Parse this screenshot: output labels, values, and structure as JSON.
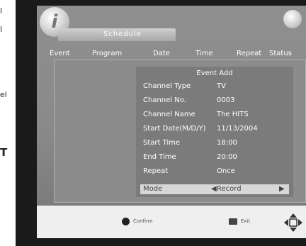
{
  "edge_fragments": [
    "l",
    "l",
    "el",
    "T"
  ],
  "screen": {
    "title": "Schedule",
    "columns": [
      "Event",
      "Program",
      "Date",
      "Time",
      "Repeat",
      "Status"
    ]
  },
  "dialog": {
    "title": "Event Add",
    "rows": [
      {
        "label": "Channel Type",
        "value": "TV"
      },
      {
        "label": "Channel No.",
        "value": "0003"
      },
      {
        "label": "Channel Name",
        "value": "The HITS"
      },
      {
        "label": "Start Date(M/D/Y)",
        "value": "11/13/2004"
      },
      {
        "label": "Start Time",
        "value": "18:00"
      },
      {
        "label": "End Time",
        "value": "20:00"
      },
      {
        "label": "Repeat",
        "value": "Once"
      }
    ],
    "mode": {
      "label": "Mode",
      "value": "Record"
    }
  },
  "helpbar": {
    "confirm_label": "Confirm",
    "exit_label": "Exit",
    "dpad_icon": "dpad-arrows-icon"
  }
}
